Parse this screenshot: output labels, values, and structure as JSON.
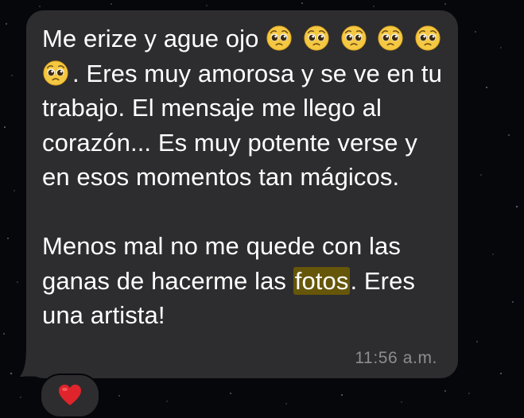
{
  "message": {
    "text_part1": "Me erize y ague ojo",
    "emoji_name": "pleading-face-emoji",
    "emoji_count": 6,
    "text_part2": ". Eres muy amorosa y se ve en tu trabajo. El mensaje me llego al corazón... Es muy potente verse y en esos momentos tan mágicos.",
    "text_part3": "Menos mal no me quede con las ganas de hacerme las ",
    "highlighted_word": "fotos",
    "text_part4": ". Eres una artista!",
    "timestamp": "11:56 a.m."
  },
  "reaction": {
    "icon": "heart-icon",
    "color": "#e0242c"
  },
  "colors": {
    "bubble": "#2d2d2f",
    "background": "#06070b",
    "highlight": "#66560a",
    "text": "#ffffff",
    "timestamp": "#8d8d92"
  }
}
